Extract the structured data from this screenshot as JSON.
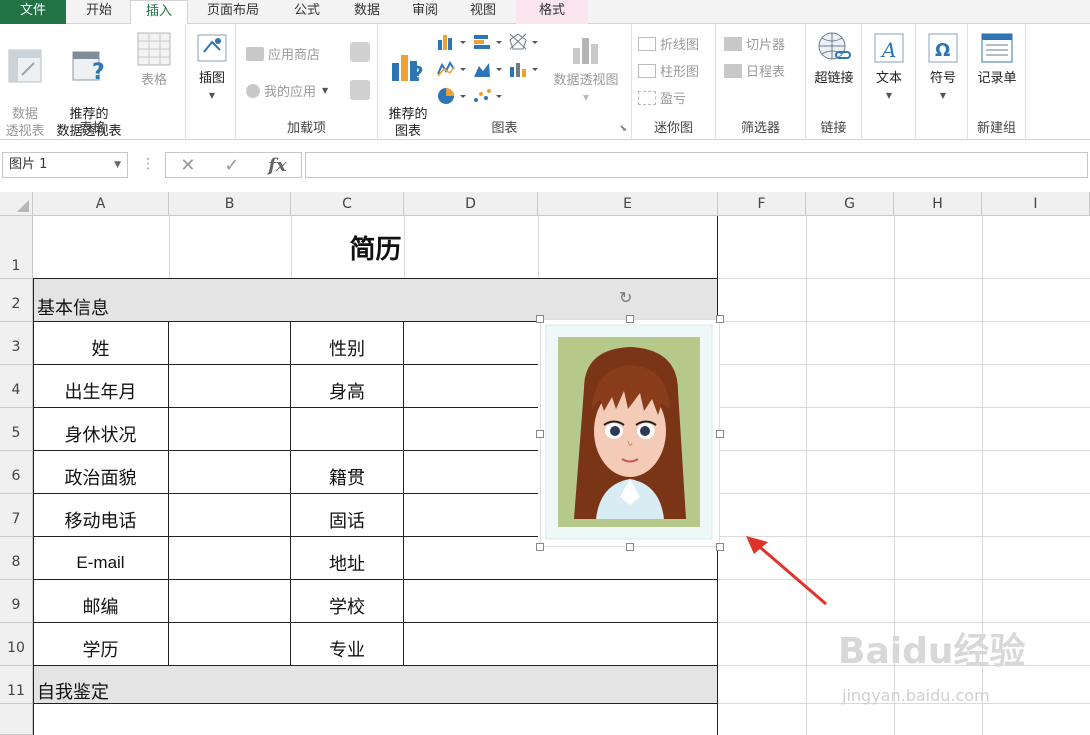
{
  "tabs": [
    "文件",
    "开始",
    "插入",
    "页面布局",
    "公式",
    "数据",
    "审阅",
    "视图",
    "格式"
  ],
  "ribbon": {
    "tables": {
      "label": "表格",
      "pivot": "数据\n透视表",
      "rec_pivot": "推荐的\n数据透视表",
      "table": "表格"
    },
    "illustrations": {
      "label": "插图"
    },
    "addins": {
      "label": "加载项",
      "store": "应用商店",
      "my_apps": "我的应用"
    },
    "charts": {
      "label": "图表",
      "rec_charts": "推荐的\n图表",
      "pivot_chart": "数据透视图"
    },
    "sparklines": {
      "label": "迷你图",
      "line": "折线图",
      "column": "柱形图",
      "winloss": "盈亏"
    },
    "filters": {
      "label": "筛选器",
      "slicer": "切片器",
      "timeline": "日程表"
    },
    "links": {
      "label": "链接",
      "hyperlink": "超链接"
    },
    "text": {
      "label": "文本"
    },
    "symbols": {
      "label": "符号"
    },
    "newgroup": {
      "label": "新建组",
      "form": "记录单"
    }
  },
  "formula_bar": {
    "name_box": "图片 1",
    "formula": ""
  },
  "columns": [
    "A",
    "B",
    "C",
    "D",
    "E",
    "F",
    "G",
    "H",
    "I"
  ],
  "rows": [
    "1",
    "2",
    "3",
    "4",
    "5",
    "6",
    "7",
    "8",
    "9",
    "10",
    "11"
  ],
  "sheet": {
    "title": "简历",
    "section_basic": "基本信息",
    "section_self": "自我鉴定",
    "labels_left": [
      "姓",
      "出生年月",
      "身休状况",
      "政治面貌",
      "移动电话",
      "E-mail",
      "邮编",
      "学历"
    ],
    "labels_right": [
      "性别",
      "身高",
      "",
      "籍贯",
      "固话",
      "地址",
      "学校",
      "专业"
    ]
  },
  "watermark": {
    "text": "Baidu经验",
    "sub": "jingyan.baidu.com"
  }
}
